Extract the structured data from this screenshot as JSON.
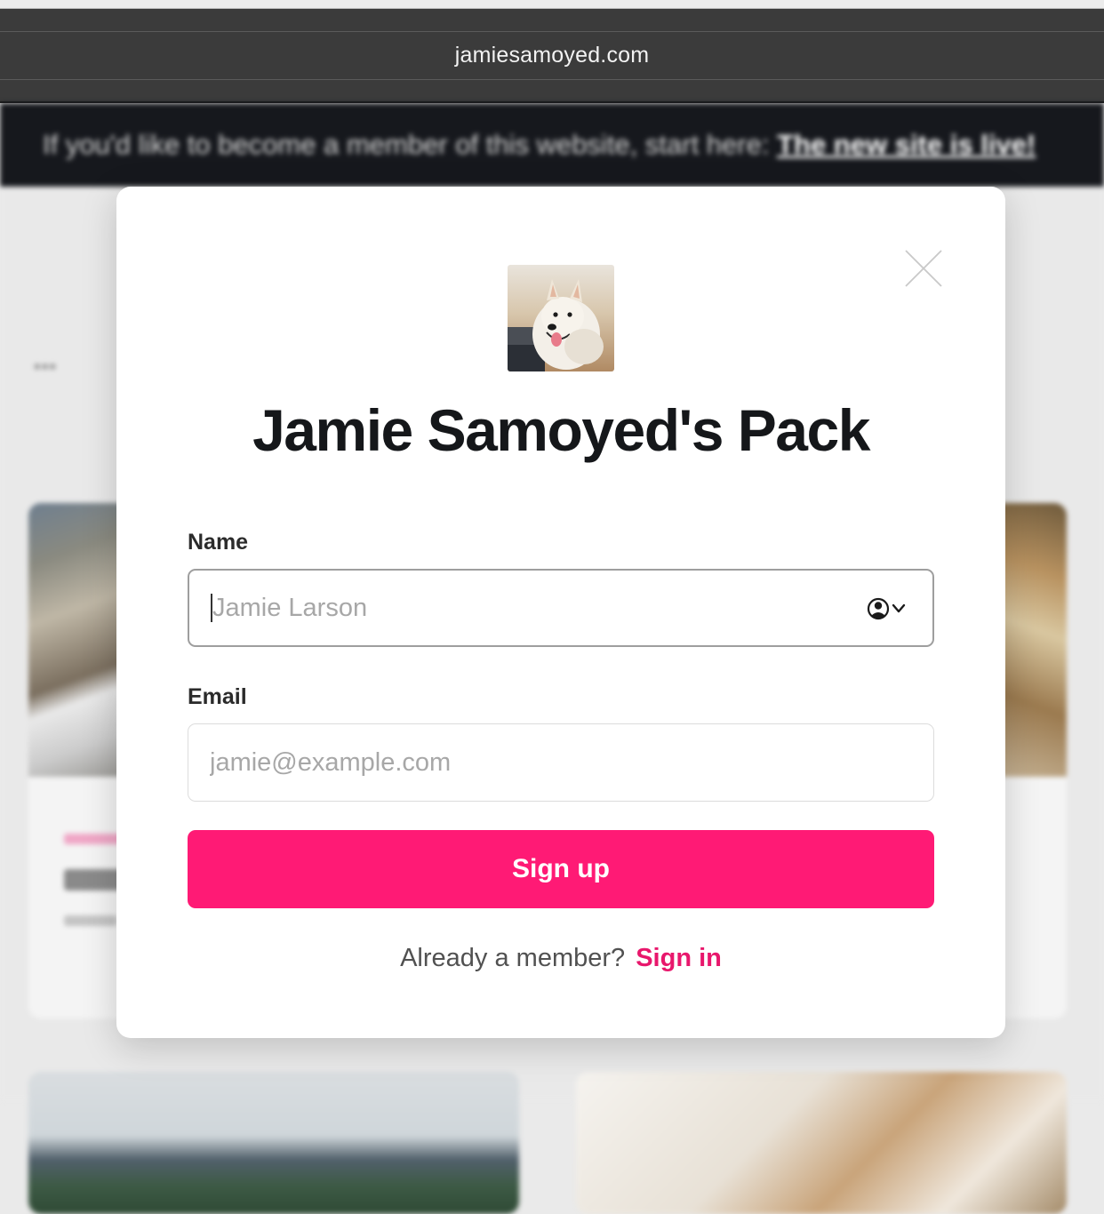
{
  "browser": {
    "url": "jamiesamoyed.com"
  },
  "background_page": {
    "banner_text": "If you'd like to become a member of this website, start here: ",
    "banner_link": "The new site is live!",
    "menu_dots": "•••"
  },
  "modal": {
    "site_title": "Jamie Samoyed's Pack",
    "logo_icon": "samoyed-dog-photo",
    "close_icon": "close-icon",
    "name_label": "Name",
    "name_placeholder": "Jamie Larson",
    "email_label": "Email",
    "email_placeholder": "jamie@example.com",
    "signup_label": "Sign up",
    "footer_prompt": "Already a member?",
    "signin_label": "Sign in"
  },
  "colors": {
    "accent": "#ff1a75",
    "link": "#e8176c",
    "banner_bg": "#16181d",
    "chrome_bg": "#3b3b3b"
  }
}
